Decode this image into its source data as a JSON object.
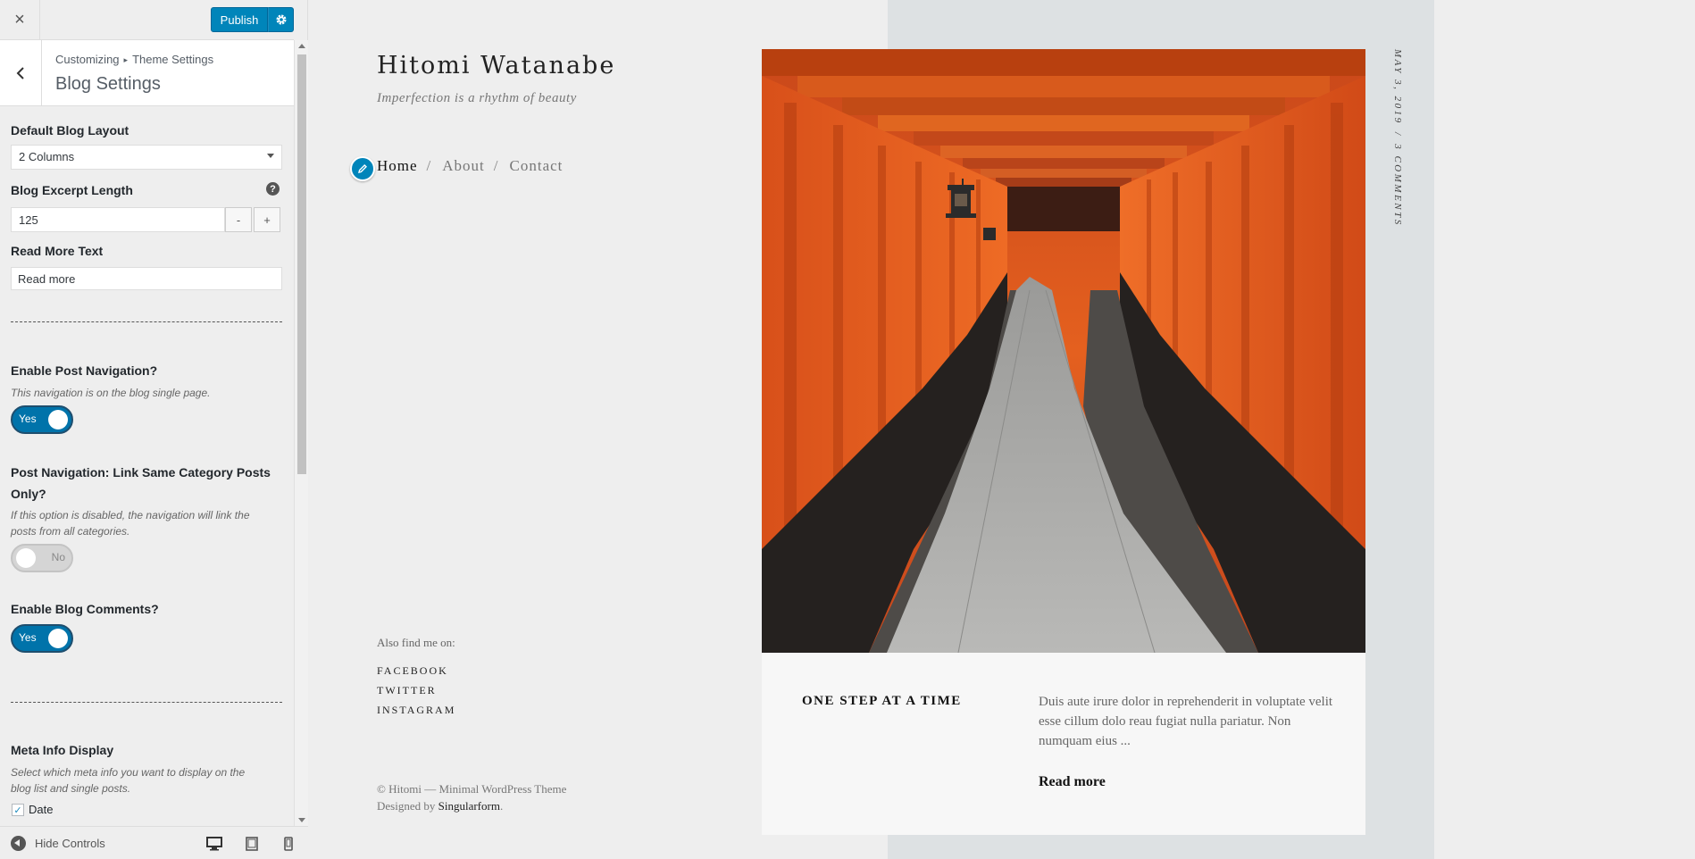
{
  "customizer": {
    "close_label": "×",
    "publish_label": "Publish",
    "breadcrumb": {
      "root": "Customizing",
      "separator": "▸",
      "parent": "Theme Settings"
    },
    "section_title": "Blog Settings",
    "controls": {
      "layout": {
        "label": "Default Blog Layout",
        "value": "2 Columns"
      },
      "excerpt": {
        "label": "Blog Excerpt Length",
        "help": "?",
        "value": "125",
        "minus": "-",
        "plus": "+"
      },
      "read_more": {
        "label": "Read More Text",
        "value": "Read more"
      },
      "post_nav": {
        "label": "Enable Post Navigation?",
        "description": "This navigation is on the blog single page.",
        "toggle": "Yes",
        "enabled": true
      },
      "same_cat": {
        "label_line1": "Post Navigation: Link Same Category Posts",
        "label_line2": "Only?",
        "description_line1": "If this option is disabled, the navigation will link the",
        "description_line2": "posts from all categories.",
        "toggle": "No",
        "enabled": false
      },
      "comments": {
        "label": "Enable Blog Comments?",
        "toggle": "Yes",
        "enabled": true
      },
      "meta": {
        "label": "Meta Info Display",
        "description_line1": "Select which meta info you want to display on the",
        "description_line2": "blog list and single posts.",
        "checkbox_label": "Date",
        "checked": true
      }
    },
    "footer": {
      "hide_controls": "Hide Controls"
    },
    "colors": {
      "accent": "#0085ba",
      "toggle_on": "#0073aa"
    }
  },
  "preview": {
    "site_title": "Hitomi Watanabe",
    "tagline": "Imperfection is a rhythm of beauty",
    "nav": {
      "home": "Home",
      "about": "About",
      "contact": "Contact",
      "separator": "/"
    },
    "find_me": "Also find me on:",
    "social": {
      "facebook": "FACEBOOK",
      "twitter": "TWITTER",
      "instagram": "INSTAGRAM"
    },
    "copyright": "© Hitomi — Minimal WordPress Theme",
    "designed_by_prefix": "Designed by ",
    "designer": "Singularform",
    "designed_by_suffix": ".",
    "post": {
      "title": "ONE STEP AT A TIME",
      "excerpt": "Duis aute irure dolor in reprehenderit in voluptate velit esse cillum dolo reau fugiat nulla pariatur. Non numquam eius ...",
      "read_more": "Read more",
      "date": "MAY 3, 2019",
      "meta_sep": "/",
      "comments": "3 COMMENTS"
    }
  }
}
